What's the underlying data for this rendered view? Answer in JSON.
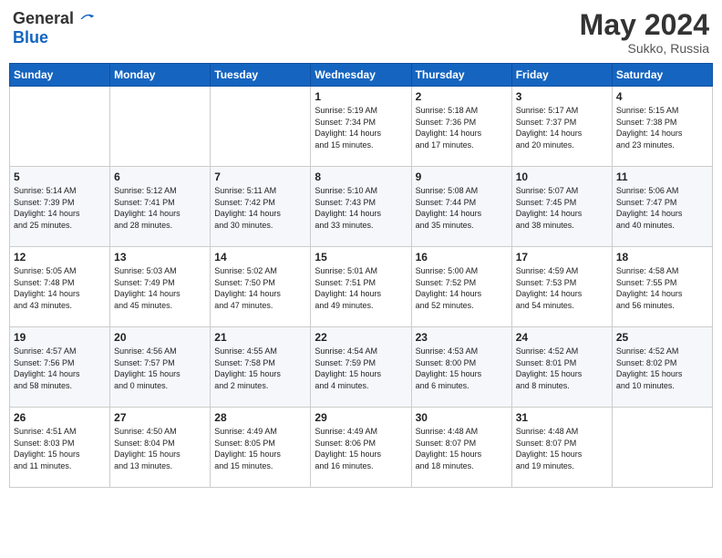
{
  "logo": {
    "general": "General",
    "blue": "Blue"
  },
  "title": {
    "month_year": "May 2024",
    "location": "Sukko, Russia"
  },
  "headers": [
    "Sunday",
    "Monday",
    "Tuesday",
    "Wednesday",
    "Thursday",
    "Friday",
    "Saturday"
  ],
  "weeks": [
    [
      {
        "day": "",
        "info": ""
      },
      {
        "day": "",
        "info": ""
      },
      {
        "day": "",
        "info": ""
      },
      {
        "day": "1",
        "info": "Sunrise: 5:19 AM\nSunset: 7:34 PM\nDaylight: 14 hours\nand 15 minutes."
      },
      {
        "day": "2",
        "info": "Sunrise: 5:18 AM\nSunset: 7:36 PM\nDaylight: 14 hours\nand 17 minutes."
      },
      {
        "day": "3",
        "info": "Sunrise: 5:17 AM\nSunset: 7:37 PM\nDaylight: 14 hours\nand 20 minutes."
      },
      {
        "day": "4",
        "info": "Sunrise: 5:15 AM\nSunset: 7:38 PM\nDaylight: 14 hours\nand 23 minutes."
      }
    ],
    [
      {
        "day": "5",
        "info": "Sunrise: 5:14 AM\nSunset: 7:39 PM\nDaylight: 14 hours\nand 25 minutes."
      },
      {
        "day": "6",
        "info": "Sunrise: 5:12 AM\nSunset: 7:41 PM\nDaylight: 14 hours\nand 28 minutes."
      },
      {
        "day": "7",
        "info": "Sunrise: 5:11 AM\nSunset: 7:42 PM\nDaylight: 14 hours\nand 30 minutes."
      },
      {
        "day": "8",
        "info": "Sunrise: 5:10 AM\nSunset: 7:43 PM\nDaylight: 14 hours\nand 33 minutes."
      },
      {
        "day": "9",
        "info": "Sunrise: 5:08 AM\nSunset: 7:44 PM\nDaylight: 14 hours\nand 35 minutes."
      },
      {
        "day": "10",
        "info": "Sunrise: 5:07 AM\nSunset: 7:45 PM\nDaylight: 14 hours\nand 38 minutes."
      },
      {
        "day": "11",
        "info": "Sunrise: 5:06 AM\nSunset: 7:47 PM\nDaylight: 14 hours\nand 40 minutes."
      }
    ],
    [
      {
        "day": "12",
        "info": "Sunrise: 5:05 AM\nSunset: 7:48 PM\nDaylight: 14 hours\nand 43 minutes."
      },
      {
        "day": "13",
        "info": "Sunrise: 5:03 AM\nSunset: 7:49 PM\nDaylight: 14 hours\nand 45 minutes."
      },
      {
        "day": "14",
        "info": "Sunrise: 5:02 AM\nSunset: 7:50 PM\nDaylight: 14 hours\nand 47 minutes."
      },
      {
        "day": "15",
        "info": "Sunrise: 5:01 AM\nSunset: 7:51 PM\nDaylight: 14 hours\nand 49 minutes."
      },
      {
        "day": "16",
        "info": "Sunrise: 5:00 AM\nSunset: 7:52 PM\nDaylight: 14 hours\nand 52 minutes."
      },
      {
        "day": "17",
        "info": "Sunrise: 4:59 AM\nSunset: 7:53 PM\nDaylight: 14 hours\nand 54 minutes."
      },
      {
        "day": "18",
        "info": "Sunrise: 4:58 AM\nSunset: 7:55 PM\nDaylight: 14 hours\nand 56 minutes."
      }
    ],
    [
      {
        "day": "19",
        "info": "Sunrise: 4:57 AM\nSunset: 7:56 PM\nDaylight: 14 hours\nand 58 minutes."
      },
      {
        "day": "20",
        "info": "Sunrise: 4:56 AM\nSunset: 7:57 PM\nDaylight: 15 hours\nand 0 minutes."
      },
      {
        "day": "21",
        "info": "Sunrise: 4:55 AM\nSunset: 7:58 PM\nDaylight: 15 hours\nand 2 minutes."
      },
      {
        "day": "22",
        "info": "Sunrise: 4:54 AM\nSunset: 7:59 PM\nDaylight: 15 hours\nand 4 minutes."
      },
      {
        "day": "23",
        "info": "Sunrise: 4:53 AM\nSunset: 8:00 PM\nDaylight: 15 hours\nand 6 minutes."
      },
      {
        "day": "24",
        "info": "Sunrise: 4:52 AM\nSunset: 8:01 PM\nDaylight: 15 hours\nand 8 minutes."
      },
      {
        "day": "25",
        "info": "Sunrise: 4:52 AM\nSunset: 8:02 PM\nDaylight: 15 hours\nand 10 minutes."
      }
    ],
    [
      {
        "day": "26",
        "info": "Sunrise: 4:51 AM\nSunset: 8:03 PM\nDaylight: 15 hours\nand 11 minutes."
      },
      {
        "day": "27",
        "info": "Sunrise: 4:50 AM\nSunset: 8:04 PM\nDaylight: 15 hours\nand 13 minutes."
      },
      {
        "day": "28",
        "info": "Sunrise: 4:49 AM\nSunset: 8:05 PM\nDaylight: 15 hours\nand 15 minutes."
      },
      {
        "day": "29",
        "info": "Sunrise: 4:49 AM\nSunset: 8:06 PM\nDaylight: 15 hours\nand 16 minutes."
      },
      {
        "day": "30",
        "info": "Sunrise: 4:48 AM\nSunset: 8:07 PM\nDaylight: 15 hours\nand 18 minutes."
      },
      {
        "day": "31",
        "info": "Sunrise: 4:48 AM\nSunset: 8:07 PM\nDaylight: 15 hours\nand 19 minutes."
      },
      {
        "day": "",
        "info": ""
      }
    ]
  ]
}
